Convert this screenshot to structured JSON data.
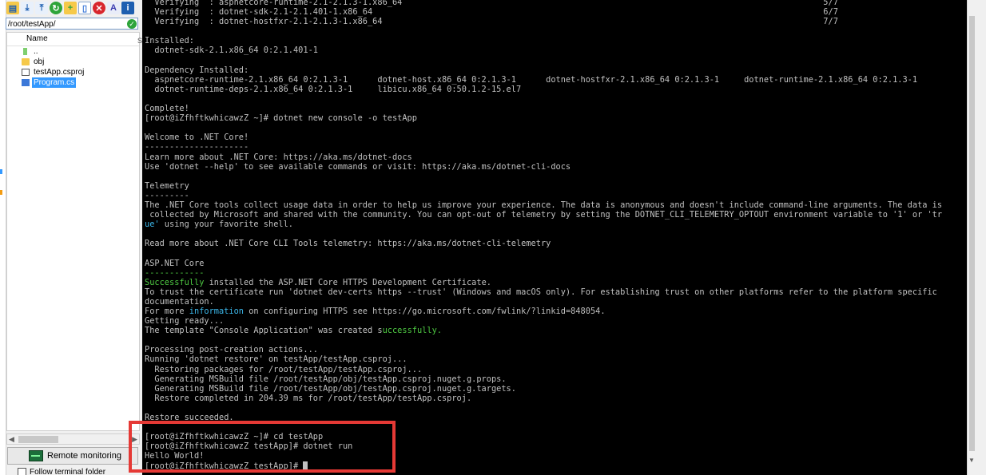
{
  "window": {
    "accent": "#3399ff",
    "highlight_color": "#e53935"
  },
  "toolbar": {
    "icons": [
      "open-folder-icon",
      "download-icon",
      "upload-icon",
      "refresh-icon",
      "new-folder-icon",
      "new-file-icon",
      "delete-icon",
      "text-mode-icon",
      "info-icon"
    ]
  },
  "file_panel": {
    "path": "/root/testApp/",
    "column_name": "Name",
    "column_sep": "S",
    "files": [
      {
        "name": "..",
        "type": "parent"
      },
      {
        "name": "obj",
        "type": "folder"
      },
      {
        "name": "testApp.csproj",
        "type": "file"
      },
      {
        "name": "Program.cs",
        "type": "cs",
        "selected": true
      }
    ],
    "remote_monitoring_label": "Remote monitoring",
    "follow_label": "Follow terminal folder"
  },
  "terminal": {
    "lines": [
      "  Verifying  : aspnetcore-runtime-2.1-2.1.3-1.x86_64                                                                                     5/7",
      "  Verifying  : dotnet-sdk-2.1-2.1.401-1.x86_64                                                                                           6/7",
      "  Verifying  : dotnet-hostfxr-2.1-2.1.3-1.x86_64                                                                                         7/7",
      "",
      "Installed:",
      "  dotnet-sdk-2.1.x86_64 0:2.1.401-1",
      "",
      "Dependency Installed:",
      "  aspnetcore-runtime-2.1.x86_64 0:2.1.3-1      dotnet-host.x86_64 0:2.1.3-1      dotnet-hostfxr-2.1.x86_64 0:2.1.3-1     dotnet-runtime-2.1.x86_64 0:2.1.3-1",
      "  dotnet-runtime-deps-2.1.x86_64 0:2.1.3-1     libicu.x86_64 0:50.1.2-15.el7",
      "",
      "Complete!",
      "[root@iZfhftkwhicawzZ ~]# dotnet new console -o testApp",
      "",
      "Welcome to .NET Core!",
      "---------------------",
      "Learn more about .NET Core: https://aka.ms/dotnet-docs",
      "Use 'dotnet --help' to see available commands or visit: https://aka.ms/dotnet-cli-docs",
      "",
      "Telemetry",
      "---------",
      "The .NET Core tools collect usage data in order to help us improve your experience. The data is anonymous and doesn't include command-line arguments. The data is",
      " collected by Microsoft and shared with the community. You can opt-out of telemetry by setting the DOTNET_CLI_TELEMETRY_OPTOUT environment variable to '1' or 'tr",
      "ue' using your favorite shell.",
      "",
      "Read more about .NET Core CLI Tools telemetry: https://aka.ms/dotnet-cli-telemetry",
      "",
      "ASP.NET Core",
      "------------",
      "Successfully installed the ASP.NET Core HTTPS Development Certificate.",
      "To trust the certificate run 'dotnet dev-certs https --trust' (Windows and macOS only). For establishing trust on other platforms refer to the platform specific",
      "documentation.",
      "For more information on configuring HTTPS see https://go.microsoft.com/fwlink/?linkid=848054.",
      "Getting ready...",
      "The template \"Console Application\" was created successfully.",
      "",
      "Processing post-creation actions...",
      "Running 'dotnet restore' on testApp/testApp.csproj...",
      "  Restoring packages for /root/testApp/testApp.csproj...",
      "  Generating MSBuild file /root/testApp/obj/testApp.csproj.nuget.g.props.",
      "  Generating MSBuild file /root/testApp/obj/testApp.csproj.nuget.g.targets.",
      "  Restore completed in 204.39 ms for /root/testApp/testApp.csproj.",
      "",
      "Restore succeeded.",
      "",
      "[root@iZfhftkwhicawzZ ~]# cd testApp",
      "[root@iZfhftkwhicawzZ testApp]# dotnet run",
      "Hello World!",
      "[root@iZfhftkwhicawzZ testApp]# "
    ],
    "highlights": [
      {
        "line": 23,
        "start": 0,
        "len": 3,
        "color": "cyn"
      },
      {
        "line": 22,
        "start": 161,
        "len": 2,
        "color": "cyn"
      },
      {
        "line": 29,
        "start": 0,
        "len": 12,
        "color": "grn"
      },
      {
        "line": 28,
        "start": 0,
        "len": 12,
        "color": "grn"
      },
      {
        "line": 32,
        "start": 9,
        "len": 11,
        "color": "cyn"
      },
      {
        "line": 34,
        "start": 48,
        "len": 12,
        "color": "grn"
      },
      {
        "line": 44,
        "start": 8,
        "len": 9,
        "color": "grn"
      }
    ]
  }
}
